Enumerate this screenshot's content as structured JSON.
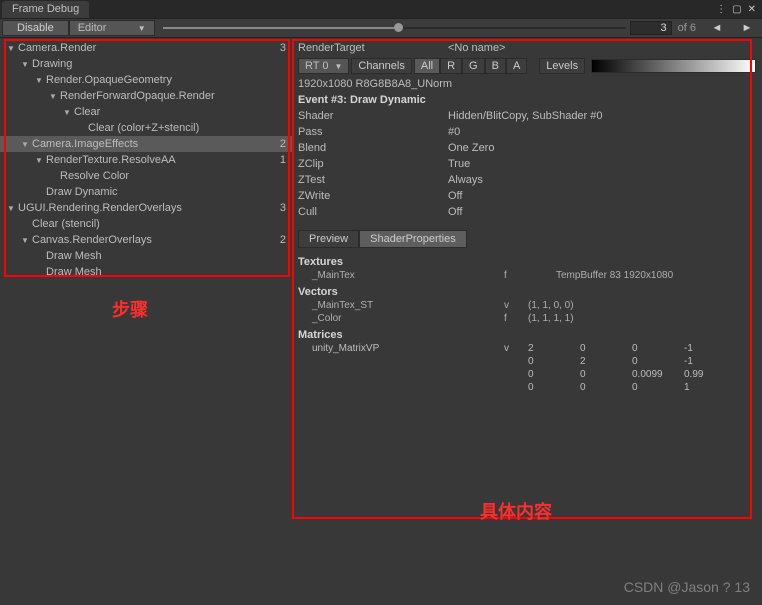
{
  "title": "Frame Debug",
  "toolbar": {
    "disable": "Disable",
    "editor": "Editor",
    "value": "3",
    "of": "of 6"
  },
  "tree": [
    {
      "depth": 0,
      "fold": "▼",
      "name": "Camera.Render",
      "count": "3",
      "sel": false
    },
    {
      "depth": 1,
      "fold": "▼",
      "name": "Drawing",
      "count": "",
      "sel": false
    },
    {
      "depth": 2,
      "fold": "▼",
      "name": "Render.OpaqueGeometry",
      "count": "",
      "sel": false
    },
    {
      "depth": 3,
      "fold": "▼",
      "name": "RenderForwardOpaque.Render",
      "count": "",
      "sel": false
    },
    {
      "depth": 4,
      "fold": "▼",
      "name": "Clear",
      "count": "",
      "sel": false
    },
    {
      "depth": 5,
      "fold": "",
      "name": "Clear (color+Z+stencil)",
      "count": "",
      "sel": false
    },
    {
      "depth": 1,
      "fold": "▼",
      "name": "Camera.ImageEffects",
      "count": "2",
      "sel": true
    },
    {
      "depth": 2,
      "fold": "▼",
      "name": "RenderTexture.ResolveAA",
      "count": "1",
      "sel": false
    },
    {
      "depth": 3,
      "fold": "",
      "name": "Resolve Color",
      "count": "",
      "sel": false
    },
    {
      "depth": 2,
      "fold": "",
      "name": "Draw Dynamic",
      "count": "",
      "sel": false
    },
    {
      "depth": 0,
      "fold": "▼",
      "name": "UGUI.Rendering.RenderOverlays",
      "count": "3",
      "sel": false
    },
    {
      "depth": 1,
      "fold": "",
      "name": "Clear (stencil)",
      "count": "",
      "sel": false
    },
    {
      "depth": 1,
      "fold": "▼",
      "name": "Canvas.RenderOverlays",
      "count": "2",
      "sel": false
    },
    {
      "depth": 2,
      "fold": "",
      "name": "Draw Mesh",
      "count": "",
      "sel": false
    },
    {
      "depth": 2,
      "fold": "",
      "name": "Draw Mesh",
      "count": "",
      "sel": false
    }
  ],
  "details": {
    "renderTargetLabel": "RenderTarget",
    "renderTargetName": "<No name>",
    "rtDropdown": "RT 0",
    "channelsLabel": "Channels",
    "channels": [
      "All",
      "R",
      "G",
      "B",
      "A"
    ],
    "levelsLabel": "Levels",
    "resolution": "1920x1080 R8G8B8A8_UNorm",
    "eventTitle": "Event #3: Draw Dynamic",
    "kv": [
      {
        "k": "Shader",
        "v": "Hidden/BlitCopy, SubShader #0"
      },
      {
        "k": "Pass",
        "v": "#0"
      },
      {
        "k": "Blend",
        "v": "One Zero"
      },
      {
        "k": "ZClip",
        "v": "True"
      },
      {
        "k": "ZTest",
        "v": "Always"
      },
      {
        "k": "ZWrite",
        "v": "Off"
      },
      {
        "k": "Cull",
        "v": "Off"
      }
    ],
    "tabs": {
      "preview": "Preview",
      "shaderProps": "ShaderProperties"
    },
    "textures": {
      "header": "Textures",
      "items": [
        {
          "name": "_MainTex",
          "type": "f",
          "val": "TempBuffer 83 1920x1080"
        }
      ]
    },
    "vectors": {
      "header": "Vectors",
      "items": [
        {
          "name": "_MainTex_ST",
          "type": "v",
          "val": "(1, 1, 0, 0)"
        },
        {
          "name": "_Color",
          "type": "f",
          "val": "(1, 1, 1, 1)"
        }
      ]
    },
    "matrices": {
      "header": "Matrices",
      "name": "unity_MatrixVP",
      "type": "v",
      "rows": [
        [
          "2",
          "0",
          "0",
          "-1"
        ],
        [
          "0",
          "2",
          "0",
          "-1"
        ],
        [
          "0",
          "0",
          "0.0099",
          "0.99"
        ],
        [
          "0",
          "0",
          "0",
          "1"
        ]
      ]
    }
  },
  "annotations": {
    "left": "步骤",
    "right": "具体内容"
  },
  "watermark": "CSDN @Jason ? 13"
}
